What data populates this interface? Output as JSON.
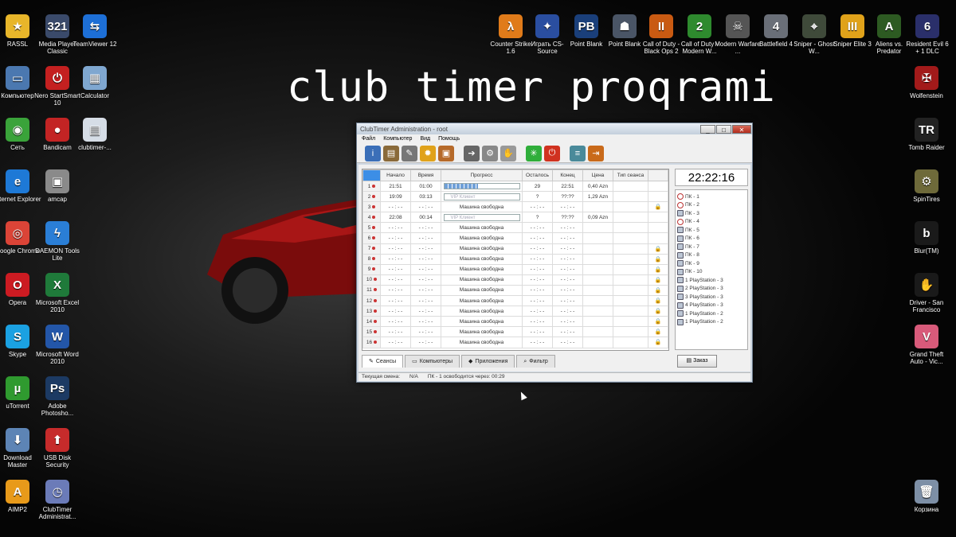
{
  "overlay_title": "club timer proqrami",
  "desktop_left": [
    {
      "label": "RASSL",
      "icon": "star-icon",
      "color": "#e8b62a",
      "glyph": "★"
    },
    {
      "label": "Media Player Classic",
      "icon": "media-player-icon",
      "color": "#3a4a6a",
      "glyph": "321"
    },
    {
      "label": "TeamViewer 12",
      "icon": "teamviewer-icon",
      "color": "#1d6fd6",
      "glyph": "⇆"
    },
    {
      "label": "Компьютер",
      "icon": "computer-icon",
      "color": "#4b78b0",
      "glyph": "▭"
    },
    {
      "label": "Nero StartSmart 10",
      "icon": "nero-icon",
      "color": "#c42020",
      "glyph": "⏻"
    },
    {
      "label": "Calculator",
      "icon": "calculator-icon",
      "color": "#7fa7d0",
      "glyph": "▦"
    },
    {
      "label": "Сеть",
      "icon": "network-icon",
      "color": "#3aa33a",
      "glyph": "◉"
    },
    {
      "label": "Bandicam",
      "icon": "bandicam-icon",
      "color": "#c32424",
      "glyph": "●"
    },
    {
      "label": "clubtimer-...",
      "icon": "clubtimer-file-icon",
      "color": "#d6dde6",
      "glyph": "▤"
    },
    {
      "label": "Internet Explorer",
      "icon": "internet-explorer-icon",
      "color": "#1e79d6",
      "glyph": "e"
    },
    {
      "label": "amcap",
      "icon": "amcap-icon",
      "color": "#8a8a8a",
      "glyph": "▣"
    },
    {
      "label": "Google Chrome",
      "icon": "chrome-icon",
      "color": "#db4437",
      "glyph": "◎"
    },
    {
      "label": "DAEMON Tools Lite",
      "icon": "daemon-tools-icon",
      "color": "#2a7ed6",
      "glyph": "ϟ"
    },
    {
      "label": "Opera",
      "icon": "opera-icon",
      "color": "#cc1b22",
      "glyph": "O"
    },
    {
      "label": "Microsoft Excel 2010",
      "icon": "excel-icon",
      "color": "#1f7a3a",
      "glyph": "X"
    },
    {
      "label": "Skype",
      "icon": "skype-icon",
      "color": "#1ba1e2",
      "glyph": "S"
    },
    {
      "label": "Microsoft Word 2010",
      "icon": "word-icon",
      "color": "#2356a8",
      "glyph": "W"
    },
    {
      "label": "uTorrent",
      "icon": "utorrent-icon",
      "color": "#2f9a2f",
      "glyph": "µ"
    },
    {
      "label": "Adobe Photosho...",
      "icon": "photoshop-icon",
      "color": "#1c3a63",
      "glyph": "Ps"
    },
    {
      "label": "Download Master",
      "icon": "download-master-icon",
      "color": "#5d84b5",
      "glyph": "⬇"
    },
    {
      "label": "USB Disk Security",
      "icon": "usb-security-icon",
      "color": "#c62b2b",
      "glyph": "⬆"
    },
    {
      "label": "AIMP2",
      "icon": "aimp-icon",
      "color": "#e89a1a",
      "glyph": "A"
    },
    {
      "label": "ClubTimer Administrat...",
      "icon": "clubtimer-app-icon",
      "color": "#6b7bb8",
      "glyph": "◷"
    }
  ],
  "desktop_top": [
    {
      "label": "Counter Strike 1.6",
      "icon": "half-life-icon",
      "color": "#e07b1a",
      "glyph": "λ"
    },
    {
      "label": "Играть CS-Source",
      "icon": "cs-source-icon",
      "color": "#2a4ea0",
      "glyph": "✦"
    },
    {
      "label": "Point Blank",
      "icon": "point-blank-icon",
      "color": "#1a3f7a",
      "glyph": "PB"
    },
    {
      "label": "Point Blank",
      "icon": "point-blank-soldier-icon",
      "color": "#4a5566",
      "glyph": "☗"
    },
    {
      "label": "Call of Duty - Black Ops 2",
      "icon": "black-ops-icon",
      "color": "#c95a12",
      "glyph": "II"
    },
    {
      "label": "Call of Duty - Modern W...",
      "icon": "modern-warfare-icon",
      "color": "#2e8a2e",
      "glyph": "2"
    },
    {
      "label": "Modern Warfare ...",
      "icon": "modern-warfare-skull-icon",
      "color": "#555",
      "glyph": "☠"
    },
    {
      "label": "Battlefield 4",
      "icon": "battlefield-icon",
      "color": "#6a6f78",
      "glyph": "4"
    },
    {
      "label": "Sniper - Ghost W...",
      "icon": "sniper-ghost-icon",
      "color": "#3f4a3a",
      "glyph": "⌖"
    },
    {
      "label": "Sniper Elite 3",
      "icon": "sniper-elite-icon",
      "color": "#e0a21a",
      "glyph": "III"
    },
    {
      "label": "Aliens vs. Predator",
      "icon": "aliens-predator-icon",
      "color": "#2d5a22",
      "glyph": "A"
    },
    {
      "label": "Resident Evil 6 + 1 DLC",
      "icon": "resident-evil-icon",
      "color": "#2a2f6a",
      "glyph": "6"
    }
  ],
  "desktop_right": [
    {
      "label": "Wolfenstein",
      "icon": "wolfenstein-icon",
      "color": "#a21a1a",
      "glyph": "✠"
    },
    {
      "label": "Tomb Raider",
      "icon": "tomb-raider-icon",
      "color": "#222",
      "glyph": "TR"
    },
    {
      "label": "SpinTires",
      "icon": "spintires-icon",
      "color": "#6e6a3a",
      "glyph": "⚙"
    },
    {
      "label": "Blur(TM)",
      "icon": "blur-icon",
      "color": "#1a1a1a",
      "glyph": "b"
    },
    {
      "label": "Driver - San Francisco",
      "icon": "driver-icon",
      "color": "#1a1a1a",
      "glyph": "✋"
    },
    {
      "label": "Grand Theft Auto - Vic...",
      "icon": "gta-icon",
      "color": "#d85a7a",
      "glyph": "V"
    },
    {
      "label": "Корзина",
      "icon": "recycle-bin-icon",
      "color": "#7d8fa6",
      "glyph": "🗑"
    }
  ],
  "window": {
    "title": "ClubTimer Administration - root",
    "controls": [
      "_",
      "□",
      "✕"
    ],
    "menu": [
      "Файл",
      "Компьютер",
      "Вид",
      "Помощь"
    ],
    "toolbar": [
      {
        "icon": "info-icon",
        "color": "#3b6fb8",
        "glyph": "i"
      },
      {
        "icon": "session-book-icon",
        "color": "#8a6a3a",
        "glyph": "▤"
      },
      {
        "icon": "tools-icon",
        "color": "#777",
        "glyph": "✎"
      },
      {
        "icon": "settings-icon",
        "color": "#e0a21a",
        "glyph": "✹"
      },
      {
        "icon": "package-icon",
        "color": "#b66a2a",
        "glyph": "▣"
      },
      {
        "icon": "arrow-right-icon",
        "color": "#666",
        "glyph": "➔"
      },
      {
        "icon": "gears-icon",
        "color": "#888",
        "glyph": "⚙"
      },
      {
        "icon": "stop-hand-icon",
        "color": "#999",
        "glyph": "✋"
      },
      {
        "icon": "refresh-icon",
        "color": "#2fae3a",
        "glyph": "✳"
      },
      {
        "icon": "power-icon",
        "color": "#d0321f",
        "glyph": "⏻"
      },
      {
        "icon": "database-icon",
        "color": "#4a8a9a",
        "glyph": "≡"
      },
      {
        "icon": "exit-door-icon",
        "color": "#c96a1a",
        "glyph": "⇥"
      }
    ],
    "grid": {
      "columns": [
        "",
        "Начало",
        "Время",
        "Прогресс",
        "Осталось",
        "Конец",
        "Цена",
        "Тип сеанса",
        ""
      ],
      "rows": [
        {
          "n": "1",
          "start": "21:51",
          "time": "01:00",
          "progress": "bar",
          "progress_value": 0.45,
          "left": "29",
          "end": "22:51",
          "price": "0,40 Azn",
          "lock": false
        },
        {
          "n": "2",
          "start": "19:09",
          "time": "03:13",
          "progress": "VIP Клиент",
          "left": "?",
          "end": "??:??",
          "price": "1,29 Azn",
          "lock": false
        },
        {
          "n": "3",
          "start": "- - : - -",
          "time": "- - : - -",
          "progress": "Машина свободна",
          "left": "- - : - -",
          "end": "- - : - -",
          "price": "",
          "lock": true
        },
        {
          "n": "4",
          "start": "22:08",
          "time": "00:14",
          "progress": "VIP Клиент",
          "left": "?",
          "end": "??:??",
          "price": "0,09 Azn",
          "lock": false
        },
        {
          "n": "5",
          "start": "- - : - -",
          "time": "- - : - -",
          "progress": "Машина свободна",
          "left": "- - : - -",
          "end": "- - : - -",
          "price": "",
          "lock": false
        },
        {
          "n": "6",
          "start": "- - : - -",
          "time": "- - : - -",
          "progress": "Машина свободна",
          "left": "- - : - -",
          "end": "- - : - -",
          "price": "",
          "lock": false
        },
        {
          "n": "7",
          "start": "- - : - -",
          "time": "- - : - -",
          "progress": "Машина свободна",
          "left": "- - : - -",
          "end": "- - : - -",
          "price": "",
          "lock": true
        },
        {
          "n": "8",
          "start": "- - : - -",
          "time": "- - : - -",
          "progress": "Машина свободна",
          "left": "- - : - -",
          "end": "- - : - -",
          "price": "",
          "lock": true
        },
        {
          "n": "9",
          "start": "- - : - -",
          "time": "- - : - -",
          "progress": "Машина свободна",
          "left": "- - : - -",
          "end": "- - : - -",
          "price": "",
          "lock": true
        },
        {
          "n": "10",
          "start": "- - : - -",
          "time": "- - : - -",
          "progress": "Машина свободна",
          "left": "- - : - -",
          "end": "- - : - -",
          "price": "",
          "lock": true
        },
        {
          "n": "11",
          "start": "- - : - -",
          "time": "- - : - -",
          "progress": "Машина свободна",
          "left": "- - : - -",
          "end": "- - : - -",
          "price": "",
          "lock": true
        },
        {
          "n": "12",
          "start": "- - : - -",
          "time": "- - : - -",
          "progress": "Машина свободна",
          "left": "- - : - -",
          "end": "- - : - -",
          "price": "",
          "lock": true
        },
        {
          "n": "13",
          "start": "- - : - -",
          "time": "- - : - -",
          "progress": "Машина свободна",
          "left": "- - : - -",
          "end": "- - : - -",
          "price": "",
          "lock": true
        },
        {
          "n": "14",
          "start": "- - : - -",
          "time": "- - : - -",
          "progress": "Машина свободна",
          "left": "- - : - -",
          "end": "- - : - -",
          "price": "",
          "lock": true
        },
        {
          "n": "15",
          "start": "- - : - -",
          "time": "- - : - -",
          "progress": "Машина свободна",
          "left": "- - : - -",
          "end": "- - : - -",
          "price": "",
          "lock": true
        },
        {
          "n": "16",
          "start": "- - : - -",
          "time": "- - : - -",
          "progress": "Машина свободна",
          "left": "- - : - -",
          "end": "- - : - -",
          "price": "",
          "lock": true
        }
      ]
    },
    "tabs": [
      "Сеансы",
      "Компьютеры",
      "Приложения",
      "Фильтр"
    ],
    "clock": "22:22:16",
    "pc_list": [
      {
        "label": "ПК - 1",
        "type": "circle"
      },
      {
        "label": "ПК - 2",
        "type": "circle"
      },
      {
        "label": "ПК - 3",
        "type": "monitor"
      },
      {
        "label": "ПК - 4",
        "type": "circle"
      },
      {
        "label": "ПК - 5",
        "type": "monitor"
      },
      {
        "label": "ПК - 6",
        "type": "monitor"
      },
      {
        "label": "ПК - 7",
        "type": "monitor"
      },
      {
        "label": "ПК - 8",
        "type": "monitor"
      },
      {
        "label": "ПК - 9",
        "type": "monitor"
      },
      {
        "label": "ПК - 10",
        "type": "monitor"
      },
      {
        "label": "1 PlayStation - 3",
        "type": "monitor"
      },
      {
        "label": "2 PlayStation - 3",
        "type": "monitor"
      },
      {
        "label": "3 PlayStation - 3",
        "type": "monitor"
      },
      {
        "label": "4 PlayStation - 3",
        "type": "monitor"
      },
      {
        "label": "1 PlayStation - 2",
        "type": "monitor"
      },
      {
        "label": "1 PlayStation - 2",
        "type": "monitor"
      }
    ],
    "order_button": "Заказ",
    "status": {
      "shift": "Текущая смена:",
      "shift_value": "N/A",
      "message": "ПК - 1 освободится через: 00:29"
    }
  }
}
